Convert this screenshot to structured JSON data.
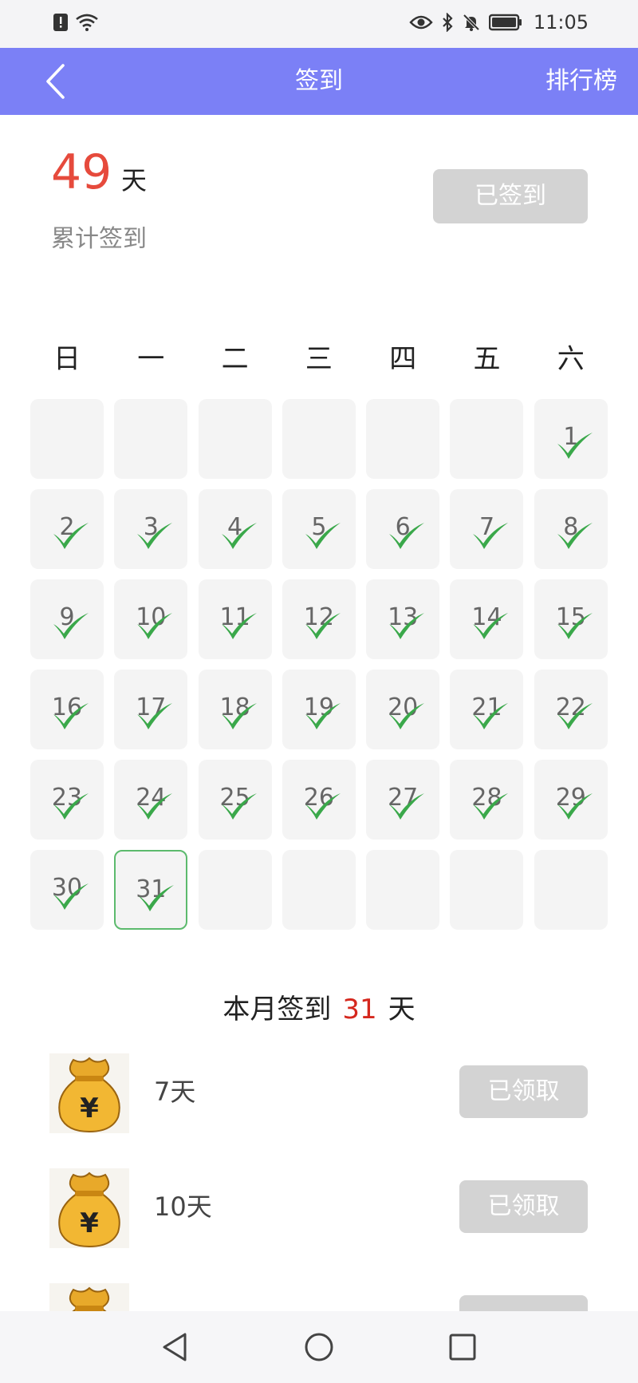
{
  "status_bar": {
    "time": "11:05",
    "left_icons": [
      "alert-icon",
      "wifi-icon"
    ],
    "right_icons": [
      "eye-icon",
      "bluetooth-icon",
      "mute-icon",
      "battery-icon"
    ]
  },
  "header": {
    "title": "签到",
    "rank_label": "排行榜",
    "color": "#7b80f6"
  },
  "summary": {
    "total_days": "49",
    "unit": "天",
    "label": "累计签到",
    "signed_button": "已签到"
  },
  "calendar": {
    "weekdays": [
      "日",
      "一",
      "二",
      "三",
      "四",
      "五",
      "六"
    ],
    "leading_blank": 6,
    "days_in_month": 31,
    "checked_days": [
      1,
      2,
      3,
      4,
      5,
      6,
      7,
      8,
      9,
      10,
      11,
      12,
      13,
      14,
      15,
      16,
      17,
      18,
      19,
      20,
      21,
      22,
      23,
      24,
      25,
      26,
      27,
      28,
      29,
      30,
      31
    ],
    "today": 31,
    "check_color": "#3aa84a"
  },
  "month_summary": {
    "prefix": "本月签到",
    "count": "31",
    "suffix": "天"
  },
  "rewards": [
    {
      "label": "7天",
      "button": "已领取",
      "icon": "money-bag-icon"
    },
    {
      "label": "10天",
      "button": "已领取",
      "icon": "money-bag-icon"
    },
    {
      "label": "",
      "button": "",
      "icon": "money-bag-icon"
    }
  ],
  "nav_bar": {
    "buttons": [
      "back-triangle-icon",
      "home-circle-icon",
      "recent-square-icon"
    ]
  }
}
